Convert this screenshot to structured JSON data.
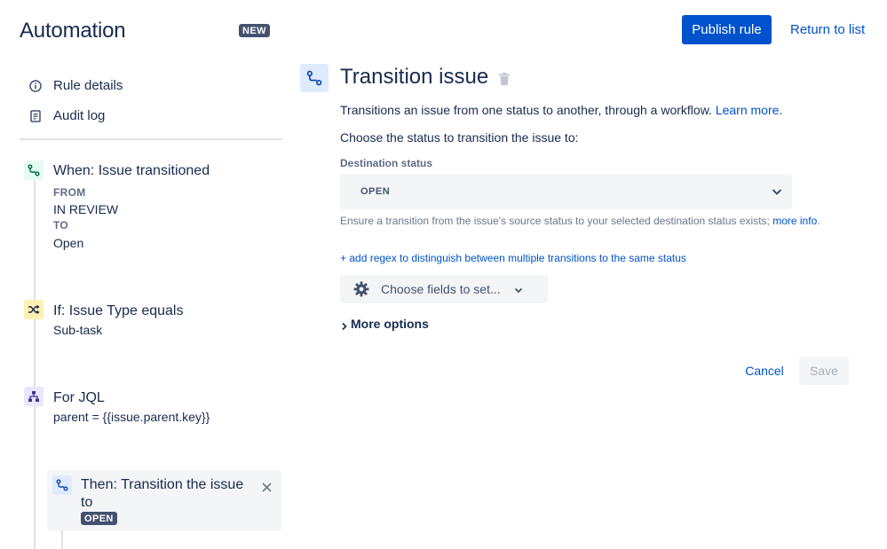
{
  "header": {
    "app_title": "Automation",
    "new_badge": "NEW",
    "publish_label": "Publish rule",
    "return_label": "Return to list"
  },
  "sidebar": {
    "nav": [
      {
        "label": "Rule details",
        "icon": "info-icon"
      },
      {
        "label": "Audit log",
        "icon": "document-icon"
      }
    ],
    "steps": {
      "trigger": {
        "title": "When: Issue transitioned",
        "from_label": "FROM",
        "from_value": "IN REVIEW",
        "to_label": "TO",
        "to_value": "Open",
        "icon": "transition-icon",
        "color": "#e3fcef"
      },
      "condition": {
        "title": "If: Issue Type equals",
        "value": "Sub-task",
        "icon": "shuffle-icon",
        "color": "#fff0b3"
      },
      "branch": {
        "title": "For JQL",
        "value": "parent = {{issue.parent.key}}",
        "icon": "hierarchy-icon",
        "color": "#eae6ff"
      },
      "action": {
        "title": "Then: Transition the issue to",
        "badge": "OPEN",
        "icon": "transition-icon",
        "color": "#deebff"
      }
    }
  },
  "main": {
    "title": "Transition issue",
    "description": "Transitions an issue from one status to another, through a workflow.",
    "learn_more": "Learn more",
    "choose_text": "Choose the status to transition the issue to:",
    "destination_label": "Destination status",
    "destination_value": "OPEN",
    "hint_text": "Ensure a transition from the issue's source status to your selected destination status exists;",
    "hint_link": "more info",
    "regex_link": "+ add regex to distinguish between multiple transitions to the same status",
    "fields_button": "Choose fields to set...",
    "more_options": "More options",
    "cancel_label": "Cancel",
    "save_label": "Save"
  },
  "colors": {
    "primary": "#0052cc",
    "text": "#172b4d",
    "subtle": "#5e6c84",
    "badge": "#42526e"
  }
}
